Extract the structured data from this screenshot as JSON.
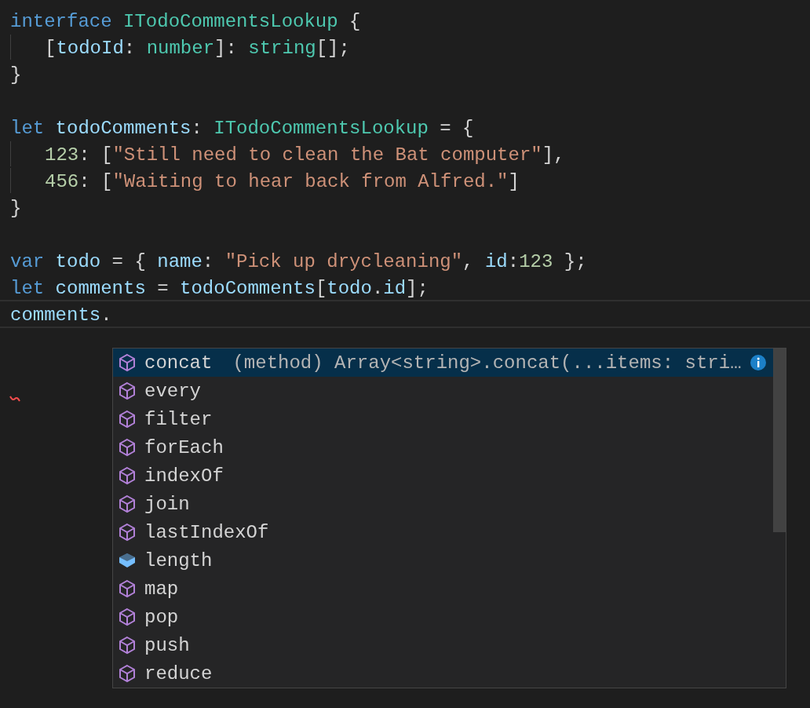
{
  "editor": {
    "lines": [
      {
        "kind": "code",
        "tokens": [
          {
            "text": "interface ",
            "kind": "keyword"
          },
          {
            "text": "ITodoCommentsLookup",
            "kind": "type"
          },
          {
            "text": " {",
            "kind": "punct"
          }
        ]
      },
      {
        "kind": "code",
        "indented": true,
        "tokens": [
          {
            "text": "[",
            "kind": "punct"
          },
          {
            "text": "todoId",
            "kind": "variable"
          },
          {
            "text": ": ",
            "kind": "punct"
          },
          {
            "text": "number",
            "kind": "type"
          },
          {
            "text": "]: ",
            "kind": "punct"
          },
          {
            "text": "string",
            "kind": "type"
          },
          {
            "text": "[];",
            "kind": "punct"
          }
        ]
      },
      {
        "kind": "code",
        "tokens": [
          {
            "text": "}",
            "kind": "punct"
          }
        ]
      },
      {
        "kind": "blank"
      },
      {
        "kind": "code",
        "tokens": [
          {
            "text": "let ",
            "kind": "keyword"
          },
          {
            "text": "todoComments",
            "kind": "variable"
          },
          {
            "text": ": ",
            "kind": "punct"
          },
          {
            "text": "ITodoCommentsLookup",
            "kind": "type"
          },
          {
            "text": " = {",
            "kind": "punct"
          }
        ]
      },
      {
        "kind": "code",
        "indented": true,
        "tokens": [
          {
            "text": "123",
            "kind": "number"
          },
          {
            "text": ": [",
            "kind": "punct"
          },
          {
            "text": "\"Still need to clean the Bat computer\"",
            "kind": "string"
          },
          {
            "text": "],",
            "kind": "punct"
          }
        ]
      },
      {
        "kind": "code",
        "indented": true,
        "tokens": [
          {
            "text": "456",
            "kind": "number"
          },
          {
            "text": ": [",
            "kind": "punct"
          },
          {
            "text": "\"Waiting to hear back from Alfred.\"",
            "kind": "string"
          },
          {
            "text": "]",
            "kind": "punct"
          }
        ]
      },
      {
        "kind": "code",
        "tokens": [
          {
            "text": "}",
            "kind": "punct"
          }
        ]
      },
      {
        "kind": "blank"
      },
      {
        "kind": "code",
        "tokens": [
          {
            "text": "var ",
            "kind": "keyword"
          },
          {
            "text": "todo",
            "kind": "variable"
          },
          {
            "text": " = { ",
            "kind": "punct"
          },
          {
            "text": "name",
            "kind": "variable"
          },
          {
            "text": ": ",
            "kind": "punct"
          },
          {
            "text": "\"Pick up drycleaning\"",
            "kind": "string"
          },
          {
            "text": ", ",
            "kind": "punct"
          },
          {
            "text": "id",
            "kind": "variable"
          },
          {
            "text": ":",
            "kind": "punct"
          },
          {
            "text": "123",
            "kind": "number"
          },
          {
            "text": " };",
            "kind": "punct"
          }
        ]
      },
      {
        "kind": "code",
        "tokens": [
          {
            "text": "let ",
            "kind": "keyword"
          },
          {
            "text": "comments",
            "kind": "variable"
          },
          {
            "text": " = ",
            "kind": "punct"
          },
          {
            "text": "todoComments",
            "kind": "variable"
          },
          {
            "text": "[",
            "kind": "punct"
          },
          {
            "text": "todo",
            "kind": "variable"
          },
          {
            "text": ".",
            "kind": "punct"
          },
          {
            "text": "id",
            "kind": "variable"
          },
          {
            "text": "];",
            "kind": "punct"
          }
        ]
      },
      {
        "kind": "code",
        "current": true,
        "tokens": [
          {
            "text": "comments",
            "kind": "variable"
          },
          {
            "text": ".",
            "kind": "punct"
          }
        ]
      }
    ]
  },
  "suggestions": [
    {
      "label": "concat",
      "kind": "method",
      "selected": true,
      "detail": "(method) Array<string>.concat(...items: stri…"
    },
    {
      "label": "every",
      "kind": "method",
      "selected": false
    },
    {
      "label": "filter",
      "kind": "method",
      "selected": false
    },
    {
      "label": "forEach",
      "kind": "method",
      "selected": false
    },
    {
      "label": "indexOf",
      "kind": "method",
      "selected": false
    },
    {
      "label": "join",
      "kind": "method",
      "selected": false
    },
    {
      "label": "lastIndexOf",
      "kind": "method",
      "selected": false
    },
    {
      "label": "length",
      "kind": "property",
      "selected": false
    },
    {
      "label": "map",
      "kind": "method",
      "selected": false
    },
    {
      "label": "pop",
      "kind": "method",
      "selected": false
    },
    {
      "label": "push",
      "kind": "method",
      "selected": false
    },
    {
      "label": "reduce",
      "kind": "method",
      "selected": false
    }
  ]
}
